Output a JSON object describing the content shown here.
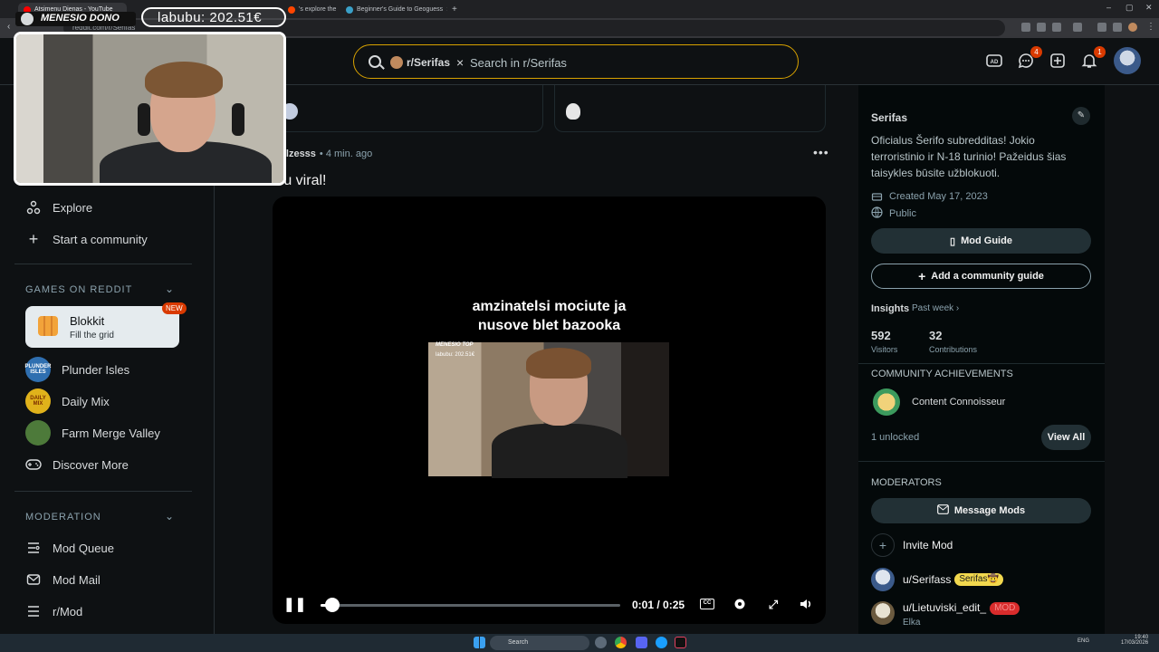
{
  "browser": {
    "tabs": [
      {
        "title": "Atsimenu Dienas - YouTube",
        "fav": "#ff0000"
      },
      {
        "title": "S",
        "fav": "#ff4500"
      },
      {
        "title": "",
        "fav": "#ff4500"
      },
      {
        "title": "'s explore the",
        "fav": "#ff4500"
      },
      {
        "title": "Beginner's Guide to Geoguess",
        "fav": "#3aa0c8"
      }
    ],
    "url": "reddit.com/r/Serifas"
  },
  "stream_overlay": {
    "streamer_name": "MENESIO DONO",
    "donation_label": "labubu: 202.51€"
  },
  "header": {
    "search_chip": "r/Serifas",
    "search_placeholder": "Search in r/Serifas",
    "chat_badge": "4",
    "notif_badge": "1"
  },
  "left_nav": {
    "explore": "Explore",
    "start_community": "Start a community",
    "games_header": "GAMES ON REDDIT",
    "blokkit_title": "Blokkit",
    "blokkit_sub": "Fill the grid",
    "new_badge": "NEW",
    "games": [
      {
        "name": "Plunder Isles",
        "icon_text": "PLUNDER ISLES",
        "color": "#2f6fb0"
      },
      {
        "name": "Daily Mix",
        "icon_text": "DAILY MIX",
        "color": "#e0b21b"
      },
      {
        "name": "Farm Merge Valley",
        "icon_text": "",
        "color": "#4d7a3a"
      }
    ],
    "discover_more": "Discover More",
    "moderation_header": "MODERATION",
    "mod_items": [
      "Mod Queue",
      "Mod Mail",
      "r/Mod"
    ]
  },
  "post": {
    "author": "u/elzesss",
    "time": "• 4 min. ago",
    "title": "...u viral!",
    "video_caption_line1": "amzinatelsi mociute ja",
    "video_caption_line2": "nusove blet bazooka",
    "inner_label1": "MENESIO TOP",
    "inner_label2": "labubu: 202.51€",
    "current_time": "0:01",
    "duration": "0:25",
    "progress_fraction": 0.04,
    "cc_label": "CC"
  },
  "community": {
    "name": "Serifas",
    "description": "Oficialus Šerifo subredditas! Jokio terroristinio ir N-18 turinio! Pažeidus šias taisykles būsite užblokuoti.",
    "created": "Created May 17, 2023",
    "visibility": "Public",
    "mod_guide": "Mod Guide",
    "add_guide": "Add a community guide",
    "insights_label": "Insights",
    "insights_period": "Past week",
    "visitors_value": "592",
    "visitors_label": "Visitors",
    "contrib_value": "32",
    "contrib_label": "Contributions",
    "achievements_header": "COMMUNITY ACHIEVEMENTS",
    "achievement_name": "Content Connoisseur",
    "unlocked": "1 unlocked",
    "view_all": "View All",
    "moderators_header": "MODERATORS",
    "message_mods": "Message Mods",
    "invite_mod": "Invite Mod",
    "mods": [
      {
        "name": "u/Serifass",
        "flair": "Serifas🤠",
        "flair_bg": "#f2d84e",
        "flair_fg": "#1a1a1a",
        "sub": ""
      },
      {
        "name": "u/Lietuviski_edit_",
        "flair": "MOD",
        "flair_bg": "#d92c2c",
        "flair_fg": "#f48a8a",
        "sub": "Elka"
      }
    ]
  },
  "taskbar": {
    "search": "Search",
    "lang": "ENG",
    "time": "19:40",
    "date": "17/03/2026"
  }
}
